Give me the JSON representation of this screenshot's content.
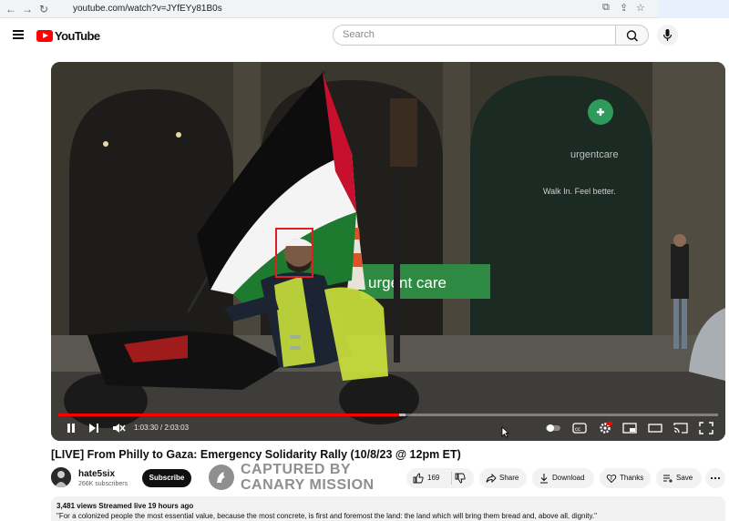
{
  "browser": {
    "url": "youtube.com/watch?v=JYfEYy81B0s"
  },
  "header": {
    "logo_text": "YouTube",
    "search_placeholder": "Search"
  },
  "player": {
    "timecode": "1:03:30 / 2:03:03",
    "progress_fraction": 0.516,
    "buffered_fraction": 0.526,
    "scene_text_sign": "urgent care",
    "scene_text_window": "Walk In. Feel better.",
    "scene_text_store": "urgentcare"
  },
  "video": {
    "title": "[LIVE] From Philly to Gaza: Emergency Solidarity Rally (10/8/23 @ 12pm ET)"
  },
  "channel": {
    "name": "hate5six",
    "subscribers": "266K subscribers",
    "subscribe_label": "Subscribe"
  },
  "watermark": {
    "line1": "CAPTURED BY",
    "line2": "CANARY MISSION"
  },
  "actions": {
    "likes": "169",
    "share": "Share",
    "download": "Download",
    "thanks": "Thanks",
    "save": "Save"
  },
  "description": {
    "stats": "3,481 views  Streamed live 19 hours ago",
    "quote": "\"For a colonized people the most essential value, because the most concrete, is first and foremost the land: the land which will bring them bread and, above all, dignity.\""
  },
  "colors": {
    "youtube_red": "#ff0000",
    "flag_green": "#1d7a2f",
    "flag_red": "#c8102e",
    "vest_yellow": "#c9e03a"
  }
}
